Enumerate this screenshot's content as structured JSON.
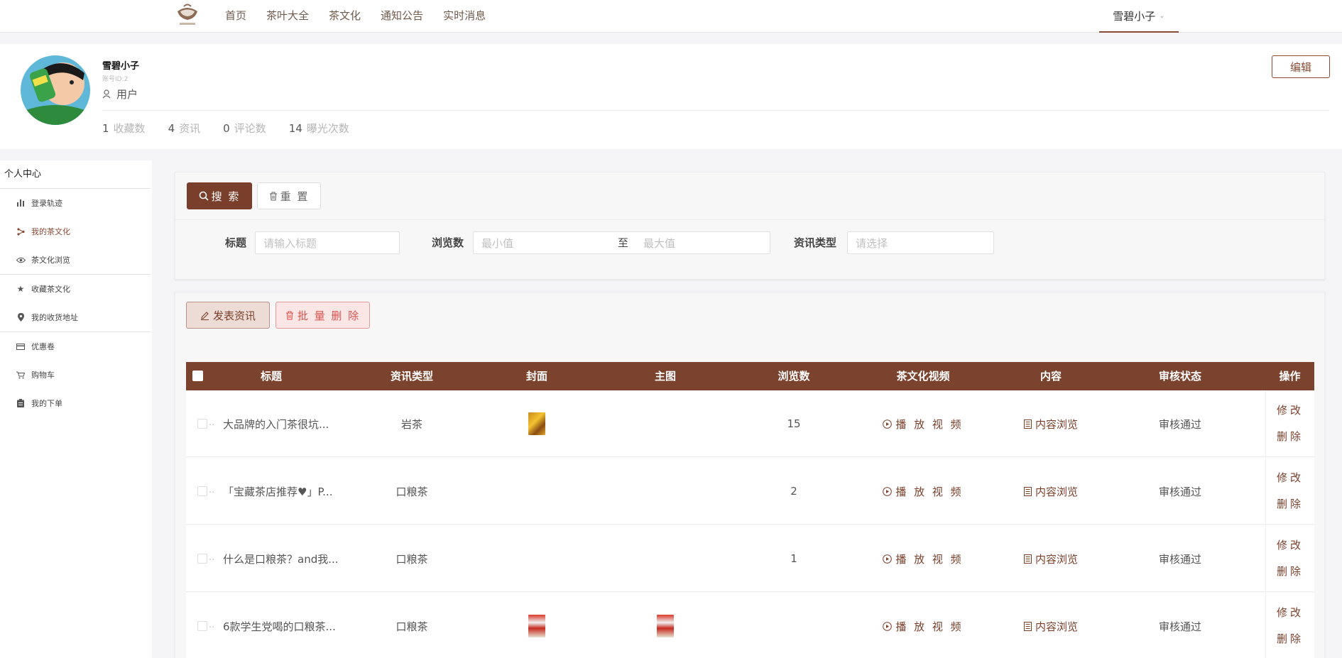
{
  "nav": {
    "links": [
      "首页",
      "茶叶大全",
      "茶文化",
      "通知公告",
      "实时消息"
    ],
    "user": "雪碧小子"
  },
  "profile": {
    "name": "雪碧小子",
    "account_id": "账号ID:2",
    "role": "用户",
    "edit_label": "编辑",
    "stats": [
      {
        "num": "1",
        "label": "收藏数"
      },
      {
        "num": "4",
        "label": "资讯"
      },
      {
        "num": "0",
        "label": "评论数"
      },
      {
        "num": "14",
        "label": "曝光次数"
      }
    ]
  },
  "sidebar": {
    "title": "个人中心",
    "items": [
      {
        "label": "登录轨迹",
        "icon": "bar-chart-icon"
      },
      {
        "label": "我的茶文化",
        "icon": "share-icon",
        "active": true
      },
      {
        "label": "茶文化浏览",
        "icon": "eye-icon"
      },
      {
        "label": "收藏茶文化",
        "icon": "star-icon"
      },
      {
        "label": "我的收货地址",
        "icon": "location-icon"
      },
      {
        "label": "优惠卷",
        "icon": "card-icon"
      },
      {
        "label": "购物车",
        "icon": "cart-icon"
      },
      {
        "label": "我的下单",
        "icon": "clipboard-icon"
      }
    ]
  },
  "search": {
    "search_label": "搜 索",
    "reset_label": "重 置",
    "title_label": "标题",
    "title_placeholder": "请输入标题",
    "views_label": "浏览数",
    "min_placeholder": "最小值",
    "to_label": "至",
    "max_placeholder": "最大值",
    "type_label": "资讯类型",
    "type_placeholder": "请选择"
  },
  "actions": {
    "publish_label": "发表资讯",
    "batch_delete_label": "批 量 删 除"
  },
  "table": {
    "headers": [
      "标题",
      "资讯类型",
      "封面",
      "主图",
      "浏览数",
      "茶文化视频",
      "内容",
      "审核状态",
      "操作"
    ],
    "rows": [
      {
        "title": "大品牌的入门茶很坑...",
        "type": "岩茶",
        "cover": true,
        "main": false,
        "views": "15",
        "video": "播 放 视 频",
        "content": "内容浏览",
        "status": "审核通过",
        "edit": "修改",
        "delete": "删除"
      },
      {
        "title": "「宝藏茶店推荐♥」P...",
        "type": "口粮茶",
        "cover": false,
        "main": false,
        "views": "2",
        "video": "播 放 视 频",
        "content": "内容浏览",
        "status": "审核通过",
        "edit": "修改",
        "delete": "删除"
      },
      {
        "title": "什么是口粮茶？and我...",
        "type": "口粮茶",
        "cover": false,
        "main": false,
        "views": "1",
        "video": "播 放 视 频",
        "content": "内容浏览",
        "status": "审核通过",
        "edit": "修改",
        "delete": "删除"
      },
      {
        "title": "6款学生党喝的口粮茶...",
        "type": "口粮茶",
        "cover": true,
        "main": true,
        "views": "",
        "video": "播 放 视 频",
        "content": "内容浏览",
        "status": "审核通过",
        "edit": "修改",
        "delete": "删除"
      }
    ]
  },
  "colors": {
    "brand": "#7b432e",
    "link": "#7a3f2a",
    "danger": "#d9534f"
  }
}
